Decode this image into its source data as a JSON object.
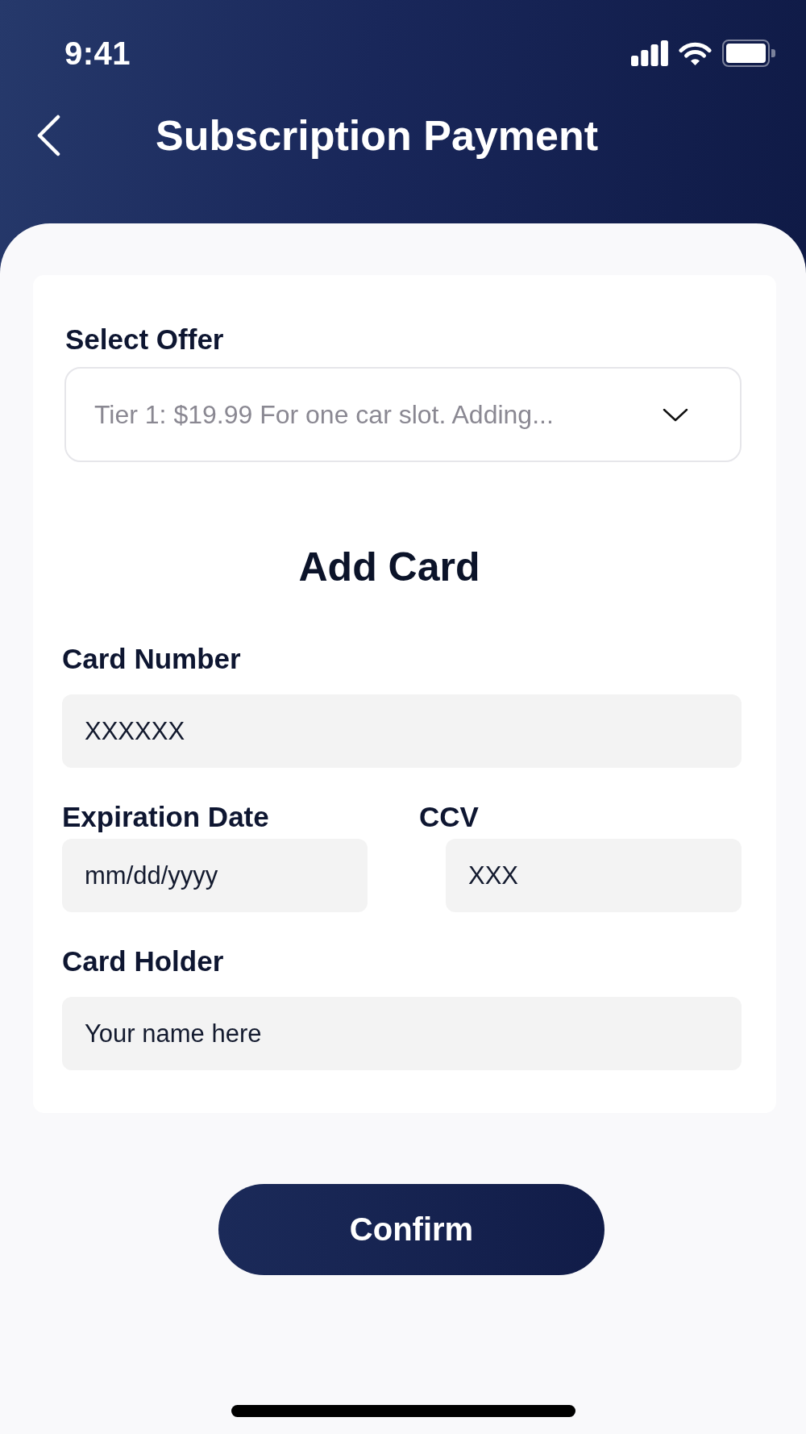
{
  "status_bar": {
    "time": "9:41"
  },
  "header": {
    "title": "Subscription Payment"
  },
  "offer": {
    "label": "Select Offer",
    "value": "Tier 1: $19.99 For one car slot. Adding..."
  },
  "card_form": {
    "heading": "Add Card",
    "rows": [
      {
        "fields": [
          {
            "label": "Card Number",
            "placeholder": "XXXXXX"
          }
        ]
      },
      {
        "fields": [
          {
            "label": "Expiration Date",
            "placeholder": "mm/dd/yyyy"
          },
          {
            "label": "CCV",
            "placeholder": "XXX"
          }
        ]
      },
      {
        "fields": [
          {
            "label": "Card Holder",
            "placeholder": "Your name here"
          }
        ]
      }
    ]
  },
  "confirm_button": {
    "label": "Confirm"
  }
}
